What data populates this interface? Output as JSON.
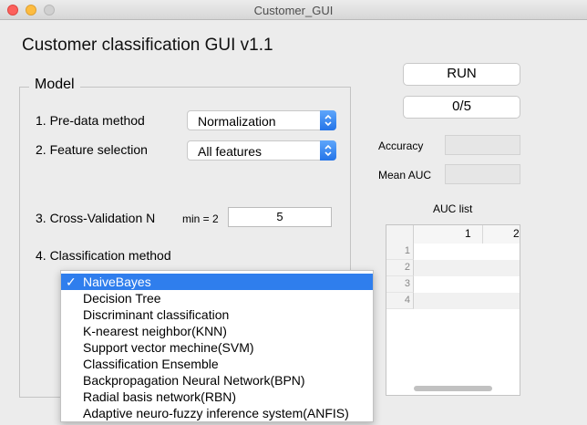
{
  "window": {
    "title": "Customer_GUI"
  },
  "app": {
    "title": "Customer classification GUI v1.1"
  },
  "model_panel": {
    "title": "Model",
    "pre_data_label": "1. Pre-data method",
    "pre_data_value": "Normalization",
    "feature_label": "2. Feature selection",
    "feature_value": "All features",
    "cv_label": "3. Cross-Validation N",
    "cv_hint": "min = 2",
    "cv_value": "5",
    "class_label": "4. Classification method"
  },
  "controls": {
    "run_label": "RUN",
    "progress": "0/5"
  },
  "results": {
    "accuracy_label": "Accuracy",
    "mean_auc_label": "Mean AUC",
    "auc_list_label": "AUC list"
  },
  "auc_table": {
    "columns": [
      "1",
      "2"
    ],
    "rows": [
      "1",
      "2",
      "3",
      "4"
    ]
  },
  "dropdown": {
    "check": "✓",
    "items": [
      "NaiveBayes",
      "Decision Tree",
      "Discriminant classification",
      "K-nearest neighbor(KNN)",
      "Support vector mechine(SVM)",
      "Classification Ensemble",
      "Backpropagation Neural Network(BPN)",
      "Radial basis network(RBN)",
      "Adaptive neuro-fuzzy inference system(ANFIS)"
    ]
  },
  "colors": {
    "accent": "#2f7eed",
    "close": "#fc605c",
    "minimize": "#fdbc40"
  }
}
